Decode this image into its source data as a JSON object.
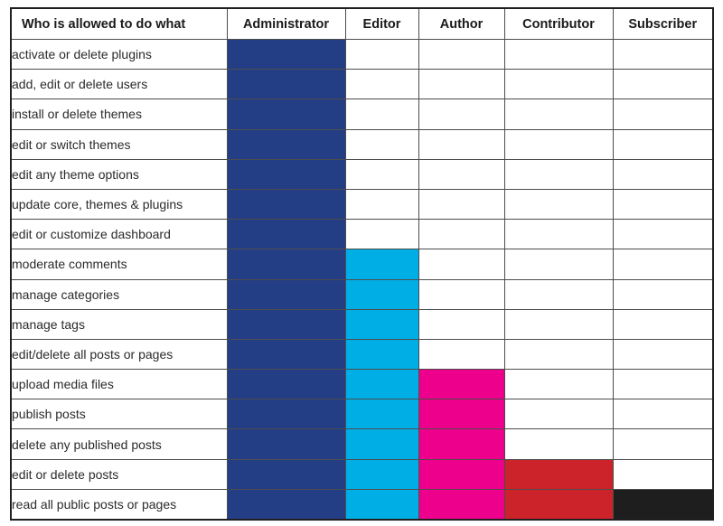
{
  "table": {
    "title": "Who is allowed to do what",
    "columns": [
      {
        "key": "task",
        "label": "Who is allowed to do what",
        "color": ""
      },
      {
        "key": "administrator",
        "label": "Administrator",
        "color": "#243e86"
      },
      {
        "key": "editor",
        "label": "Editor",
        "color": "#00aee6"
      },
      {
        "key": "author",
        "label": "Author",
        "color": "#ec008c"
      },
      {
        "key": "contributor",
        "label": "Contributor",
        "color": "#cc2229"
      },
      {
        "key": "subscriber",
        "label": "Subscriber",
        "color": "#1e1e1e"
      }
    ],
    "rows": [
      {
        "task": "activate or delete plugins",
        "allowed": [
          true,
          false,
          false,
          false,
          false
        ]
      },
      {
        "task": "add, edit or delete users",
        "allowed": [
          true,
          false,
          false,
          false,
          false
        ]
      },
      {
        "task": "install or delete themes",
        "allowed": [
          true,
          false,
          false,
          false,
          false
        ]
      },
      {
        "task": "edit or switch themes",
        "allowed": [
          true,
          false,
          false,
          false,
          false
        ]
      },
      {
        "task": "edit any theme options",
        "allowed": [
          true,
          false,
          false,
          false,
          false
        ]
      },
      {
        "task": "update core, themes & plugins",
        "allowed": [
          true,
          false,
          false,
          false,
          false
        ]
      },
      {
        "task": "edit or customize dashboard",
        "allowed": [
          true,
          false,
          false,
          false,
          false
        ]
      },
      {
        "task": "moderate comments",
        "allowed": [
          true,
          true,
          false,
          false,
          false
        ]
      },
      {
        "task": "manage categories",
        "allowed": [
          true,
          true,
          false,
          false,
          false
        ]
      },
      {
        "task": "manage tags",
        "allowed": [
          true,
          true,
          false,
          false,
          false
        ]
      },
      {
        "task": "edit/delete all posts or pages",
        "allowed": [
          true,
          true,
          false,
          false,
          false
        ]
      },
      {
        "task": "upload media files",
        "allowed": [
          true,
          true,
          true,
          false,
          false
        ]
      },
      {
        "task": "publish posts",
        "allowed": [
          true,
          true,
          true,
          false,
          false
        ]
      },
      {
        "task": "delete any published posts",
        "allowed": [
          true,
          true,
          true,
          false,
          false
        ]
      },
      {
        "task": "edit or delete posts",
        "allowed": [
          true,
          true,
          true,
          true,
          false
        ]
      },
      {
        "task": "read all public posts or pages",
        "allowed": [
          true,
          true,
          true,
          true,
          true
        ]
      }
    ],
    "palette": {
      "administrator": "#243e86",
      "editor": "#00aee6",
      "author": "#ec008c",
      "contributor": "#cc2229",
      "subscriber": "#1e1e1e",
      "empty": "#ffffff",
      "grid_line": "#4d4d4d",
      "outer_border": "#231f20",
      "text": "#2b2b2b",
      "header_text": "#1a1a1a"
    }
  }
}
